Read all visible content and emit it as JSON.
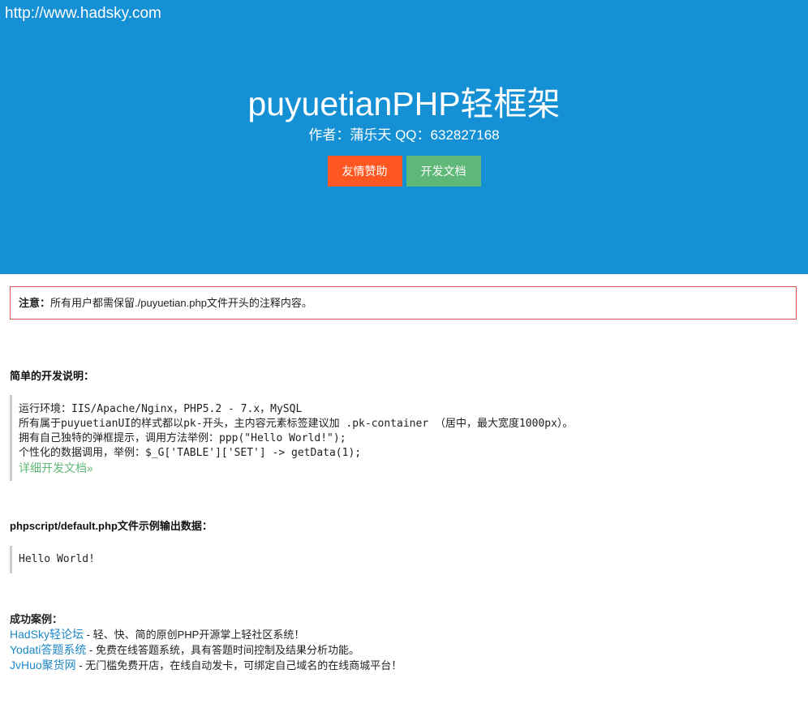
{
  "hero": {
    "url": "http://www.hadsky.com",
    "title": "puyuetianPHP轻框架",
    "author": "作者：蒲乐天 QQ：632827168",
    "donate_label": "友情赞助",
    "docs_label": "开发文档"
  },
  "notice": {
    "label": "注意：",
    "text": "所有用户都需保留./puyuetian.php文件开头的注释内容。"
  },
  "dev": {
    "heading": "简单的开发说明：",
    "lines": [
      "运行环境：IIS/Apache/Nginx，PHP5.2 - 7.x，MySQL",
      "所有属于puyuetianUI的样式都以pk-开头，主内容元素标签建议加 .pk-container （居中，最大宽度1000px）。",
      "拥有自己独特的弹框提示，调用方法举例：ppp(\"Hello World!\");",
      "个性化的数据调用，举例：$_G['TABLE']['SET'] -> getData(1);"
    ],
    "doc_link": "详细开发文档»"
  },
  "example": {
    "heading": "phpscript/default.php文件示例输出数据：",
    "output": "Hello World!"
  },
  "cases": {
    "heading": "成功案例：",
    "items": [
      {
        "name": "HadSky轻论坛",
        "desc": " - 轻、快、简的原创PHP开源掌上轻社区系统！"
      },
      {
        "name": "Yodati答题系统",
        "desc": " - 免费在线答题系统，具有答题时间控制及结果分析功能。"
      },
      {
        "name": "JvHuo聚货网",
        "desc": " - 无门槛免费开店，在线自动发卡，可绑定自己域名的在线商城平台！"
      }
    ]
  },
  "colors": {
    "hero_bg": "#1590d5",
    "donate_btn": "#ff5722",
    "docs_btn": "#5fb878",
    "notice_border": "#d9534f",
    "case_link": "#1e88c7"
  }
}
